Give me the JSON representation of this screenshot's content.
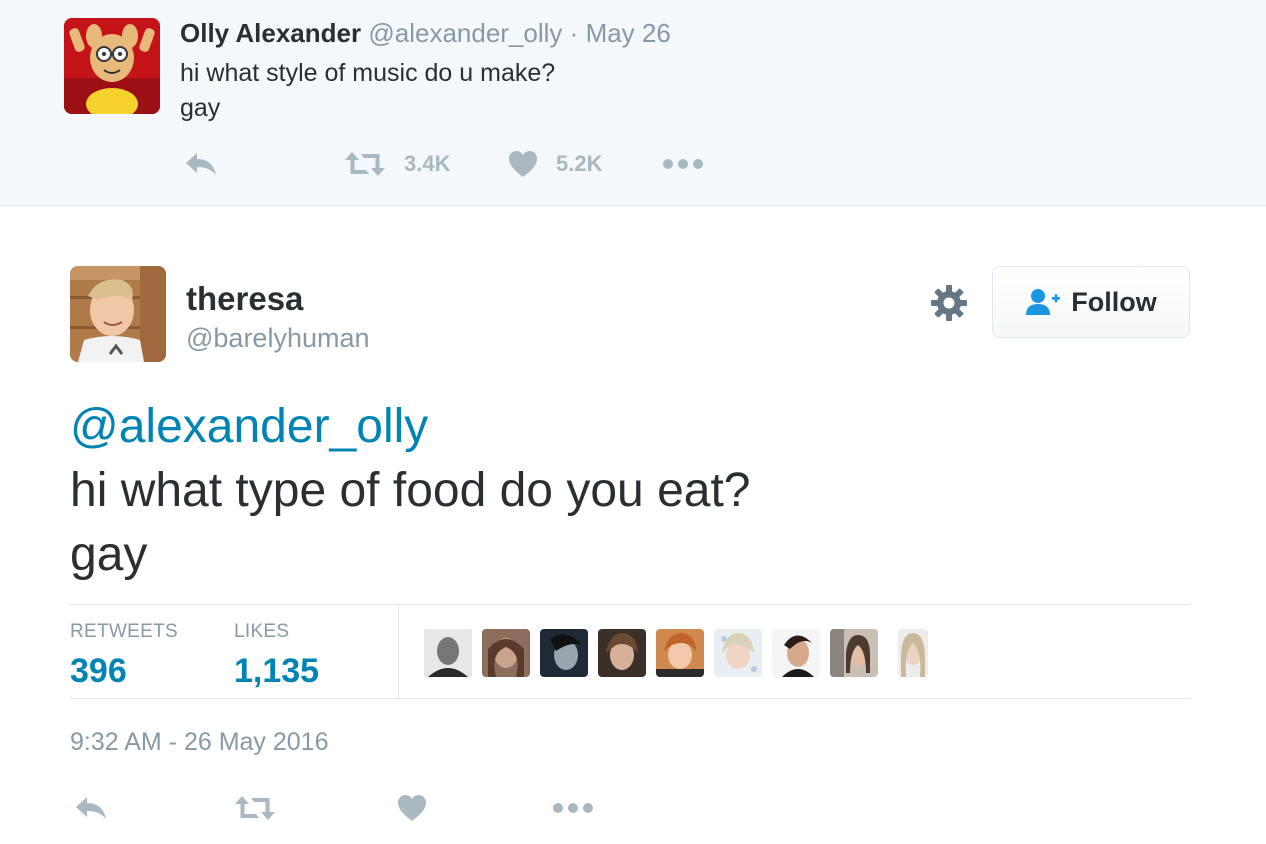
{
  "parent_tweet": {
    "author_name": "Olly Alexander",
    "author_handle": "@alexander_olly",
    "separator": "·",
    "date": "May 26",
    "lines": [
      "hi what style of music do u make?",
      "gay"
    ],
    "retweet_count": "3.4K",
    "like_count": "5.2K",
    "icons": [
      "reply-icon",
      "retweet-icon",
      "heart-icon",
      "more-icon"
    ]
  },
  "main_tweet": {
    "author_name": "theresa",
    "author_handle": "@barelyhuman",
    "follow_label": "Follow",
    "mention": "@alexander_olly",
    "lines": [
      "hi what type of food do you eat?",
      "gay"
    ],
    "stats": {
      "retweets_label": "RETWEETS",
      "retweets_value": "396",
      "likes_label": "LIKES",
      "likes_value": "1,135"
    },
    "liker_avatar_count": 9,
    "timestamp": "9:32 AM - 26 May 2016",
    "icons": [
      "gear-icon",
      "follow-person-icon",
      "reply-icon",
      "retweet-icon",
      "heart-icon",
      "more-icon"
    ]
  },
  "colors": {
    "link": "#0084b4",
    "muted": "#8899a6",
    "icon": "#aab8c2",
    "text": "#292f33",
    "parent_bg": "#f5f8fa",
    "border": "#e1e8ed"
  }
}
